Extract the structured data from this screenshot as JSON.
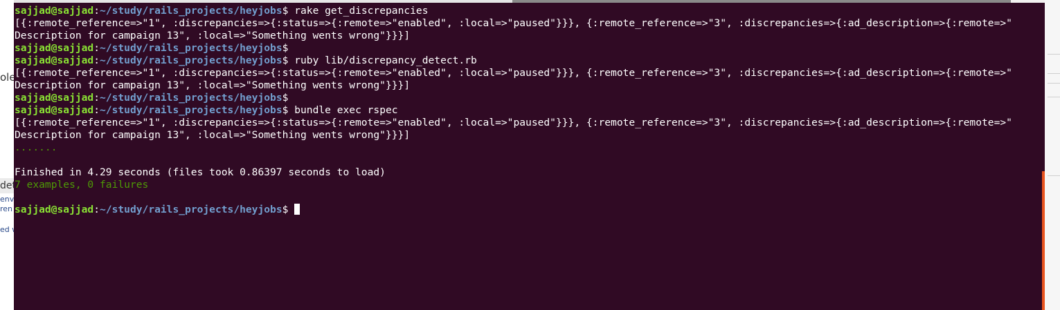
{
  "background": {
    "left_fragments": [
      "ole",
      "det",
      "env",
      "ren",
      "ed w"
    ]
  },
  "terminal": {
    "prompt": {
      "user_host": "sajjad@sajjad",
      "separator": ":",
      "path": "~/study/rails_projects/heyjobs",
      "symbol": "$"
    },
    "lines": [
      {
        "kind": "prompt",
        "command": " rake get_discrepancies"
      },
      {
        "kind": "output",
        "text": "[{:remote_reference=>\"1\", :discrepancies=>{:status=>{:remote=>\"enabled\", :local=>\"paused\"}}}, {:remote_reference=>\"3\", :discrepancies=>{:ad_description=>{:remote=>\""
      },
      {
        "kind": "output",
        "text": "Description for campaign 13\", :local=>\"Something wents wrong\"}}}]"
      },
      {
        "kind": "prompt",
        "command": ""
      },
      {
        "kind": "prompt",
        "command": " ruby lib/discrepancy_detect.rb"
      },
      {
        "kind": "output",
        "text": "[{:remote_reference=>\"1\", :discrepancies=>{:status=>{:remote=>\"enabled\", :local=>\"paused\"}}}, {:remote_reference=>\"3\", :discrepancies=>{:ad_description=>{:remote=>\""
      },
      {
        "kind": "output",
        "text": "Description for campaign 13\", :local=>\"Something wents wrong\"}}}]"
      },
      {
        "kind": "prompt",
        "command": ""
      },
      {
        "kind": "prompt",
        "command": " bundle exec rspec"
      },
      {
        "kind": "output",
        "text": "[{:remote_reference=>\"1\", :discrepancies=>{:status=>{:remote=>\"enabled\", :local=>\"paused\"}}}, {:remote_reference=>\"3\", :discrepancies=>{:ad_description=>{:remote=>\""
      },
      {
        "kind": "output",
        "text": "Description for campaign 13\", :local=>\"Something wents wrong\"}}}]"
      },
      {
        "kind": "green",
        "text": "......."
      },
      {
        "kind": "blank",
        "text": ""
      },
      {
        "kind": "output",
        "text": "Finished in 4.29 seconds (files took 0.86397 seconds to load)"
      },
      {
        "kind": "green",
        "text": "7 examples, 0 failures"
      },
      {
        "kind": "blank",
        "text": ""
      },
      {
        "kind": "prompt_cursor",
        "command": " "
      }
    ],
    "colors": {
      "background": "#300a24",
      "user_host": "#8ae234",
      "path": "#729fcf",
      "text": "#ffffff",
      "success": "#4e9a06"
    }
  }
}
